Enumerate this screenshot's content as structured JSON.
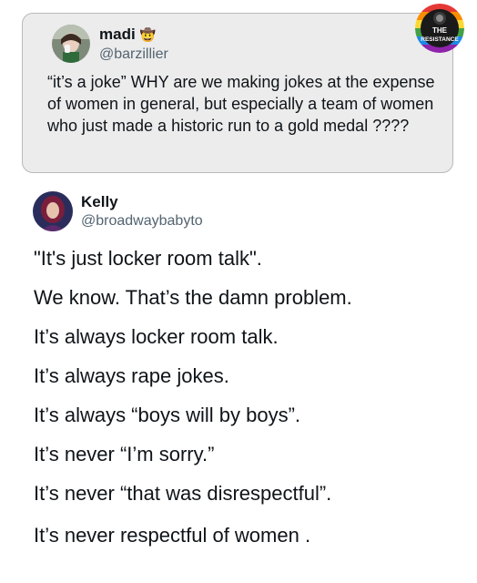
{
  "quoted_post": {
    "author_name": "madi",
    "name_emoji_icon": "cowboy-hat-face-icon",
    "author_handle": "@barzillier",
    "text": "“it’s a joke” WHY are we making jokes at the expense of women in general, but especially a team of women who just made a historic run to a gold medal ????"
  },
  "badge": {
    "line1": "THE",
    "line2": "RESISTANCE"
  },
  "post": {
    "author_name": "Kelly",
    "author_handle": "@broadwaybabyto",
    "lines": [
      "\"It's just locker room talk\".",
      "We know. That’s the damn problem.",
      "It’s always locker room talk.",
      "It’s always rape jokes.",
      "It’s always “boys will by boys”.",
      "It’s never “I’m sorry.”",
      "It’s never “that was disrespectful”.",
      "It’s never respectful of women ."
    ]
  },
  "colors": {
    "card_background": "#ececec",
    "card_border": "#b9b9b9",
    "primary_text": "#0f1419",
    "secondary_text": "#536471"
  }
}
